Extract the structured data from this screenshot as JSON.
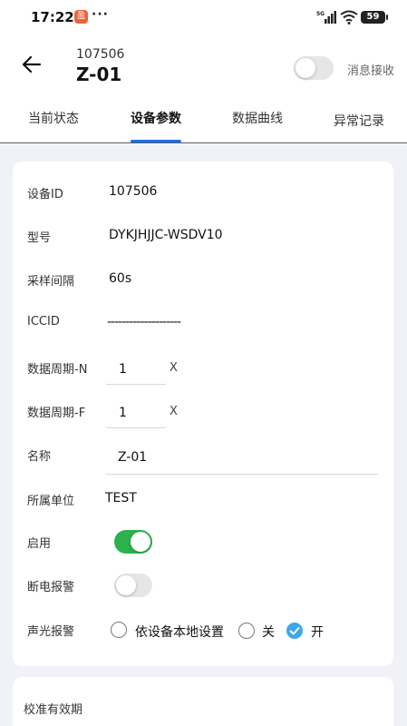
{
  "status_bar": {
    "time": "17:22",
    "app_icon_char": "盈",
    "more": "···",
    "network": "5G",
    "battery": "59"
  },
  "header": {
    "device_number": "107506",
    "device_name": "Z-01",
    "message_label": "消息接收",
    "message_on": false
  },
  "tabs": [
    {
      "label": "当前状态",
      "active": false
    },
    {
      "label": "设备参数",
      "active": true
    },
    {
      "label": "数据曲线",
      "active": false
    },
    {
      "label": "异常记录",
      "active": false
    }
  ],
  "params": {
    "device_id_label": "设备ID",
    "device_id": "107506",
    "model_label": "型号",
    "model": "DYKJHJJC-WSDV10",
    "interval_label": "采样间隔",
    "interval": "60s",
    "iccid_label": "ICCID",
    "iccid": "--------------------",
    "cycle_n_label": "数据周期-N",
    "cycle_n": "1",
    "cycle_n_unit": "X",
    "cycle_f_label": "数据周期-F",
    "cycle_f": "1",
    "cycle_f_unit": "X",
    "name_label": "名称",
    "name": "Z-01",
    "unit_label": "所属单位",
    "unit": "TEST",
    "enable_label": "启用",
    "enable": true,
    "power_alarm_label": "断电报警",
    "power_alarm": false,
    "sound_alarm_label": "声光报警",
    "sound_options": [
      "依设备本地设置",
      "关",
      "开"
    ],
    "sound_selected": "开"
  },
  "calibration": {
    "label": "校准有效期"
  },
  "colors": {
    "accent": "#1a73e8",
    "switch_on": "#2bb24c",
    "radio_checked": "#3ea7e8"
  }
}
